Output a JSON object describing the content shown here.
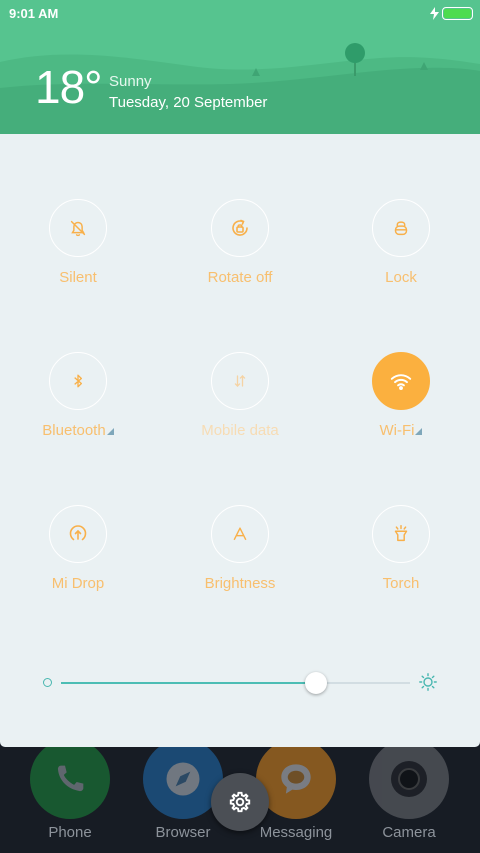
{
  "status_bar": {
    "time": "9:01 AM",
    "battery_level": 1.0,
    "charging": true,
    "battery_color": "#4ddc4f"
  },
  "weather": {
    "temperature": "18°",
    "condition": "Sunny",
    "date": "Tuesday, 20 September"
  },
  "toggles": [
    {
      "label": "Silent",
      "icon": "bell-off-icon",
      "active": false
    },
    {
      "label": "Rotate off",
      "icon": "rotate-lock-icon",
      "active": false
    },
    {
      "label": "Lock",
      "icon": "lock-icon",
      "active": false
    },
    {
      "label": "Bluetooth",
      "icon": "bluetooth-icon",
      "active": false,
      "has_submenu": true
    },
    {
      "label": "Mobile data",
      "icon": "mobile-data-icon",
      "active": false,
      "disabled": true
    },
    {
      "label": "Wi-Fi",
      "icon": "wifi-icon",
      "active": true,
      "has_submenu": true
    },
    {
      "label": "Mi Drop",
      "icon": "mi-drop-icon",
      "active": false
    },
    {
      "label": "Brightness",
      "icon": "brightness-auto-icon",
      "active": false
    },
    {
      "label": "Torch",
      "icon": "torch-icon",
      "active": false
    }
  ],
  "brightness_slider": {
    "value": 0.73,
    "min_icon": "brightness-low-icon",
    "max_icon": "brightness-high-icon"
  },
  "dock": [
    {
      "label": "Phone",
      "icon": "phone-icon",
      "color": "#1a8a3a"
    },
    {
      "label": "Browser",
      "icon": "browser-icon",
      "color": "#1f6fb5"
    },
    {
      "label": "Messaging",
      "icon": "messaging-icon",
      "color": "#e08a1e"
    },
    {
      "label": "Camera",
      "icon": "camera-icon",
      "color": "#6b6e73"
    }
  ],
  "settings_button": {
    "icon": "gear-icon"
  },
  "colors": {
    "header_green": "#56c48f",
    "accent_orange": "#fbb03f",
    "label_orange": "#f8bf6e",
    "slider_teal": "#4cbdb4",
    "panel_bg": "#eaf1f3"
  }
}
